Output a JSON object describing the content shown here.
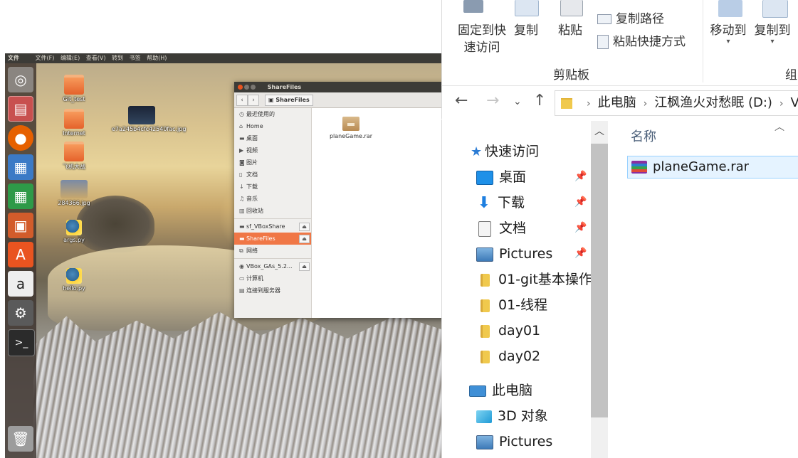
{
  "vm": {
    "menubar": {
      "app": "文件",
      "items": [
        "文件(F)",
        "编辑(E)",
        "查看(V)",
        "转到",
        "书签",
        "帮助(H)"
      ]
    },
    "desktop_icons": [
      {
        "label": "Git_test"
      },
      {
        "label": "e7a245b4cfc42540fac.jpg"
      },
      {
        "label": "Internet"
      },
      {
        "label": "飞机大战"
      },
      {
        "label": "284366.jpg"
      },
      {
        "label": "args.py"
      },
      {
        "label": "hello.py"
      }
    ],
    "nautilus": {
      "title": "ShareFiles",
      "breadcrumb": "ShareFiles",
      "sidebar": [
        "最近使用的",
        "Home",
        "桌面",
        "视频",
        "图片",
        "文档",
        "下载",
        "音乐",
        "回收站",
        "sf_VBoxShare",
        "ShareFiles",
        "网络",
        "VBox_GAs_5.2...",
        "计算机",
        "连接到服务器"
      ],
      "file": "planeGame.rar"
    }
  },
  "explorer": {
    "ribbon": {
      "pin_label": "固定到快速访问",
      "pin_line1": "固定到快",
      "pin_line2": "速访问",
      "copy": "复制",
      "paste": "粘贴",
      "copy_path": "复制路径",
      "paste_shortcut": "粘贴快捷方式",
      "move_to": "移动到",
      "copy_to": "复制到",
      "clipboard_group": "剪贴板",
      "organize_group": "组"
    },
    "address": {
      "segments": [
        "此电脑",
        "江枫渔火对愁眠 (D:)",
        "V"
      ]
    },
    "nav": {
      "quick_access": "快速访问",
      "items": [
        "桌面",
        "下载",
        "文档",
        "Pictures",
        "01-git基本操作",
        "01-线程",
        "day01",
        "day02"
      ],
      "this_pc": "此电脑",
      "pc_items": [
        "3D 对象",
        "Pictures"
      ]
    },
    "content": {
      "column_name": "名称",
      "files": [
        "planeGame.rar"
      ]
    }
  }
}
